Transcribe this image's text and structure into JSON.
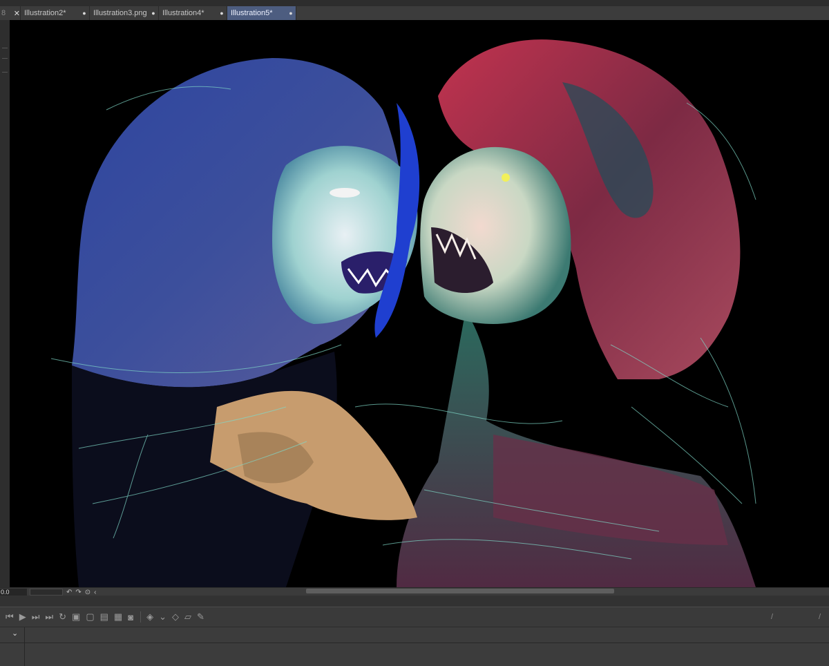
{
  "tabs": [
    {
      "label": "8",
      "state": "partial"
    },
    {
      "label": "Illustration2*"
    },
    {
      "label": "Illustration3.png"
    },
    {
      "label": "Illustration4*"
    },
    {
      "label": "Illustration5*",
      "active": true
    }
  ],
  "tab_close_glyph": "✕",
  "tab_modified_glyph": "●",
  "status": {
    "zoom_value": "0.0"
  },
  "colors": {
    "active_tab": "#4d5d80",
    "canvas_bg": "#000000",
    "panel_bg": "#3a3a3a"
  },
  "icons": [
    "rotate-left-icon",
    "rotate-right-icon",
    "reset-view-icon",
    "collapse-icon",
    "first-frame-icon",
    "play-icon",
    "next-frame-icon",
    "last-frame-icon",
    "loop-icon",
    "new-cel-icon",
    "new-folder-icon",
    "new-layer-icon",
    "delete-icon",
    "onion-skin-icon",
    "keyframe-icon",
    "dropdown-icon",
    "fill-icon",
    "transform-icon",
    "pen-icon"
  ]
}
